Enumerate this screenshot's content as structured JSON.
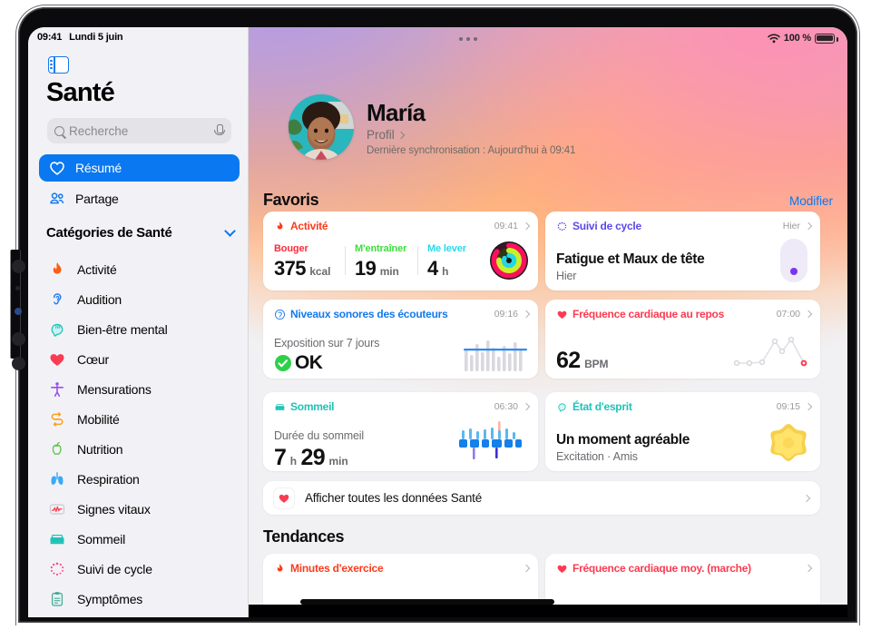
{
  "statusbar": {
    "time": "09:41",
    "date": "Lundi 5 juin",
    "battery": "100 %",
    "wifi_icon": "wifi-icon",
    "battery_icon": "battery-full-icon"
  },
  "sidebar": {
    "toggle_icon": "sidebar-toggle-icon",
    "title": "Santé",
    "search": {
      "placeholder": "Recherche",
      "value": "",
      "search_icon": "search-icon",
      "mic_icon": "microphone-icon"
    },
    "nav": [
      {
        "label": "Résumé",
        "icon": "heart-outline-icon",
        "active": true
      },
      {
        "label": "Partage",
        "icon": "two-people-icon",
        "active": false
      }
    ],
    "section_title": "Catégories de Santé",
    "section_chevron": "chevron-down-icon",
    "categories": [
      {
        "label": "Activité",
        "icon": "flame-icon",
        "color": "#fb5c17"
      },
      {
        "label": "Audition",
        "icon": "ear-icon",
        "color": "#2a7ef0"
      },
      {
        "label": "Bien-être mental",
        "icon": "head-profile-icon",
        "color": "#34c0c8"
      },
      {
        "label": "Cœur",
        "icon": "heart-filled-icon",
        "color": "#fb3b51"
      },
      {
        "label": "Mensurations",
        "icon": "body-figure-icon",
        "color": "#9b4df0"
      },
      {
        "label": "Mobilité",
        "icon": "arrows-icon",
        "color": "#fba01a"
      },
      {
        "label": "Nutrition",
        "icon": "apple-icon",
        "color": "#5ec447"
      },
      {
        "label": "Respiration",
        "icon": "lungs-icon",
        "color": "#3aa9f5"
      },
      {
        "label": "Signes vitaux",
        "icon": "vitals-waveform-icon",
        "color": "#fb3b51"
      },
      {
        "label": "Sommeil",
        "icon": "bed-icon",
        "color": "#1ec2b8"
      },
      {
        "label": "Suivi de cycle",
        "icon": "cycle-dots-icon",
        "color": "#f24a86"
      },
      {
        "label": "Symptômes",
        "icon": "clipboard-icon",
        "color": "#4aa89b"
      }
    ]
  },
  "main": {
    "multitask_handle": "multitask-handle-icon",
    "profile": {
      "avatar": "user-avatar",
      "name": "María",
      "link_label": "Profil",
      "link_chevron": "chevron-right-icon",
      "sync": "Dernière synchronisation : Aujourd'hui à 09:41"
    },
    "favoris": {
      "title": "Favoris",
      "action": "Modifier",
      "cards": [
        {
          "id": "activite",
          "title": "Activité",
          "color": "#fb3b1e",
          "icon": "flame-icon",
          "time": "09:41",
          "metrics": [
            {
              "label": "Bouger",
              "color": "#fb2d3a",
              "value": "375",
              "unit": "kcal"
            },
            {
              "label": "M'entraîner",
              "color": "#3ddc3d",
              "value": "19",
              "unit": "min"
            },
            {
              "label": "Me lever",
              "color": "#2ad8e8",
              "value": "4",
              "unit": "h"
            }
          ],
          "graphic": "activity-rings"
        },
        {
          "id": "suivi-de-cycle",
          "title": "Suivi de cycle",
          "color": "#5b4ae8",
          "icon": "cycle-dots-icon",
          "time": "Hier",
          "headline": "Fatigue et Maux de tête",
          "sub": "Hier",
          "graphic": "cycle-pill"
        },
        {
          "id": "niveaux-sonores",
          "title": "Niveaux sonores des écouteurs",
          "color": "#1479ec",
          "icon": "headphone-level-icon",
          "time": "09:16",
          "sub": "Exposition sur 7 jours",
          "status": "OK",
          "status_icon": "check-circle-icon",
          "graphic": "audio-bars"
        },
        {
          "id": "frequence-cardiaque-repos",
          "title": "Fréquence cardiaque au repos",
          "color": "#fb3b51",
          "icon": "heart-filled-icon",
          "time": "07:00",
          "value": "62",
          "unit": "BPM",
          "graphic": "heart-line"
        },
        {
          "id": "sommeil",
          "title": "Sommeil",
          "color": "#1ec2b8",
          "icon": "bed-icon",
          "time": "06:30",
          "sub": "Durée du sommeil",
          "value_h": "7",
          "unit_h": "h",
          "value_m": "29",
          "unit_m": "min",
          "graphic": "sleep-bars"
        },
        {
          "id": "etat-d-esprit",
          "title": "État d'esprit",
          "color": "#1ec2b8",
          "icon": "head-profile-icon",
          "time": "09:15",
          "headline": "Un moment agréable",
          "sub": "Excitation · Amis",
          "graphic": "mood-star"
        }
      ]
    },
    "all_data": {
      "label": "Afficher toutes les données Santé",
      "icon": "heart-filled-icon",
      "chevron": "chevron-right-icon"
    },
    "tendances": {
      "title": "Tendances",
      "cards": [
        {
          "id": "minutes-exercice",
          "title": "Minutes d'exercice",
          "color": "#fb3b1e",
          "icon": "flame-icon",
          "chevron": "chevron-right-icon"
        },
        {
          "id": "frequence-cardiaque-marche",
          "title": "Fréquence cardiaque moy. (marche)",
          "color": "#fb3b51",
          "icon": "heart-filled-icon",
          "chevron": "chevron-right-icon"
        }
      ]
    }
  }
}
